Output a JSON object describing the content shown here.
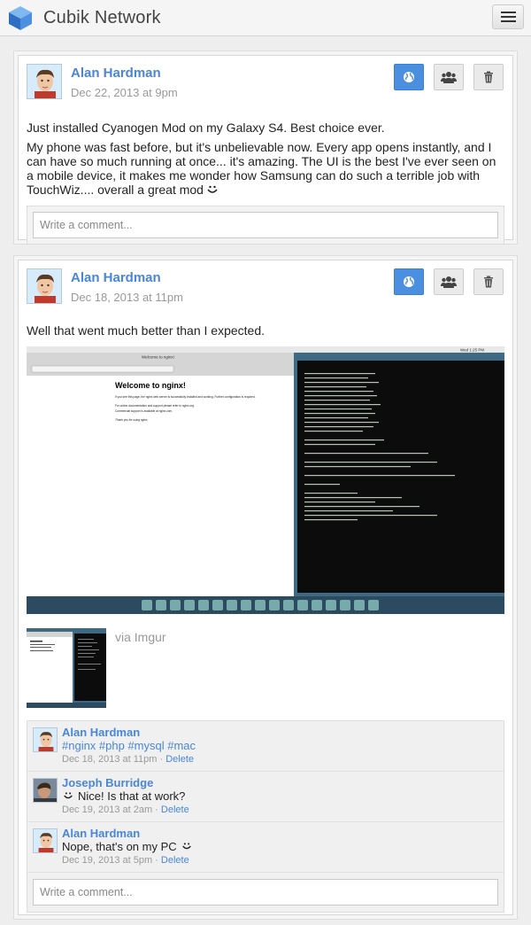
{
  "app": {
    "title": "Cubik Network"
  },
  "icons": {
    "logo": "cube-logo-icon",
    "menu": "hamburger-menu-icon",
    "public": "globe-icon",
    "friends": "group-icon",
    "delete": "trash-icon",
    "smiley": "smiley-icon"
  },
  "colors": {
    "accent": "#4a86d8",
    "active_button": "#4a8fe0"
  },
  "posts": [
    {
      "author": "Alan Hardman",
      "date": "Dec 22, 2013 at 9pm",
      "paragraphs": [
        "Just installed Cyanogen Mod on my Galaxy S4. Best choice ever.",
        "My phone was fast before, but it's unbelievable now. Every app opens instantly, and I can have so much running at once... it's amazing. The UI is the best I've ever seen on a mobile device, it makes me wonder how Samsung can do such a terrible job with TouchWiz.... overall a great mod"
      ],
      "comment_placeholder": "Write a comment..."
    },
    {
      "author": "Alan Hardman",
      "date": "Dec 18, 2013 at 11pm",
      "paragraphs": [
        "Well that went much better than I expected."
      ],
      "screenshot": {
        "window_title": "Welcome to nginx!",
        "heading": "Welcome to nginx!",
        "line1": "If you see this page, the nginx web server is successfully installed and working. Further configuration is required.",
        "line2": "For online documentation and support please refer to nginx.org.",
        "line3": "Commercial support is available at nginx.com.",
        "line4": "Thank you for using nginx.",
        "clock": "Wed 1:25 PM"
      },
      "via": "via Imgur",
      "comments": [
        {
          "author": "Alan Hardman",
          "text": "#nginx #php #mysql #mac",
          "is_tags": true,
          "date": "Dec 18, 2013 at 11pm",
          "delete": "Delete"
        },
        {
          "author": "Joseph Burridge",
          "text": "Nice! Is that at work?",
          "date": "Dec 19, 2013 at 2am",
          "delete": "Delete"
        },
        {
          "author": "Alan Hardman",
          "text": "Nope, that's on my PC",
          "date": "Dec 19, 2013 at 5pm",
          "delete": "Delete"
        }
      ],
      "comment_placeholder": "Write a comment..."
    }
  ]
}
